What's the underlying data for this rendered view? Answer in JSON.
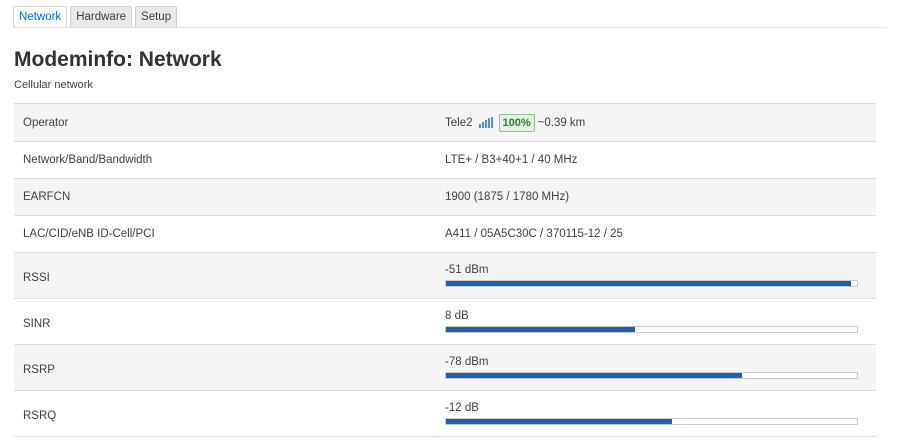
{
  "tabs": [
    {
      "label": "Network",
      "active": true
    },
    {
      "label": "Hardware",
      "active": false
    },
    {
      "label": "Setup",
      "active": false
    }
  ],
  "page": {
    "title": "Modeminfo: Network",
    "subtitle": "Cellular network"
  },
  "rows": {
    "operator": {
      "label": "Operator",
      "name": "Tele2",
      "signal_icon": "signal-bars-icon",
      "signal_percent": "100%",
      "distance": "~0.39 km"
    },
    "network": {
      "label": "Network/Band/Bandwidth",
      "value": "LTE+ / B3+40+1 / 40 MHz"
    },
    "earfcn": {
      "label": "EARFCN",
      "value": "1900 (1875 / 1780 MHz)"
    },
    "lac": {
      "label": "LAC/CID/eNB ID-Cell/PCI",
      "value": "A411 / 05A5C30C / 370115-12 / 25"
    },
    "rssi": {
      "label": "RSSI",
      "value": "-51 dBm",
      "level": 0.985
    },
    "sinr": {
      "label": "SINR",
      "value": "8 dB",
      "level": 0.46
    },
    "rsrp": {
      "label": "RSRP",
      "value": "-78 dBm",
      "level": 0.72
    },
    "rsrq": {
      "label": "RSRQ",
      "value": "-12 dB",
      "level": 0.55
    }
  },
  "colors": {
    "active_tab": "#0069d6",
    "bar_fill": "#1d60b3",
    "badge_text": "#1a8a1a",
    "badge_bg": "#e4f4e1"
  }
}
